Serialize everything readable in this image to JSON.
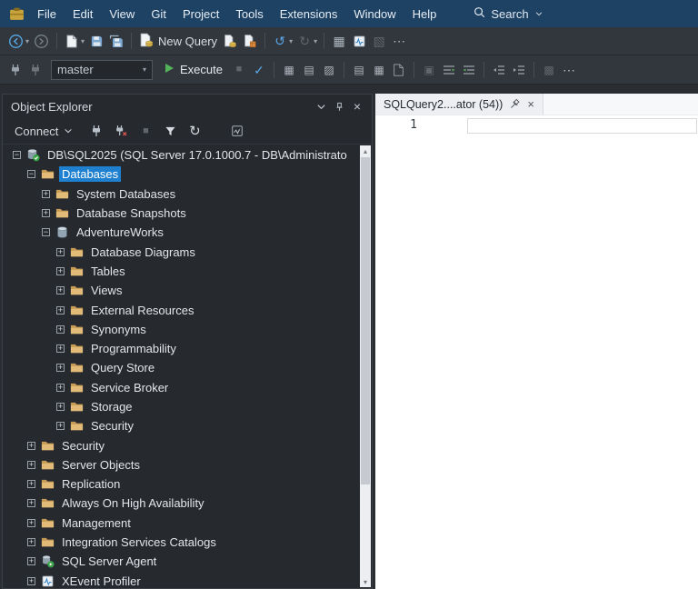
{
  "colors": {
    "menubar_bg": "#1e4264",
    "toolbar_bg": "#32373d",
    "explorer_bg": "#262a2f",
    "tree_selection": "#1f80d0",
    "execute_green": "#52b35a",
    "folder_yellow": "#e2bb79",
    "editor_bg": "#ffffff"
  },
  "menubar": {
    "items": [
      "File",
      "Edit",
      "View",
      "Git",
      "Project",
      "Tools",
      "Extensions",
      "Window",
      "Help"
    ],
    "search_label": "Search"
  },
  "standard_toolbar": {
    "new_query_label": "New Query"
  },
  "query_toolbar": {
    "database_value": "master",
    "execute_label": "Execute"
  },
  "object_explorer": {
    "title": "Object Explorer",
    "connect_label": "Connect",
    "tree": [
      {
        "label": "DB\\SQL2025 (SQL Server 17.0.1000.7 - DB\\Administrato",
        "level": 0,
        "icon": "server",
        "expander": "minus"
      },
      {
        "label": "Databases",
        "level": 1,
        "icon": "folder",
        "expander": "minus",
        "selected": true
      },
      {
        "label": "System Databases",
        "level": 2,
        "icon": "folder",
        "expander": "plus"
      },
      {
        "label": "Database Snapshots",
        "level": 2,
        "icon": "folder",
        "expander": "plus"
      },
      {
        "label": "AdventureWorks",
        "level": 2,
        "icon": "database",
        "expander": "minus"
      },
      {
        "label": "Database Diagrams",
        "level": 3,
        "icon": "folder",
        "expander": "plus"
      },
      {
        "label": "Tables",
        "level": 3,
        "icon": "folder",
        "expander": "plus"
      },
      {
        "label": "Views",
        "level": 3,
        "icon": "folder",
        "expander": "plus"
      },
      {
        "label": "External Resources",
        "level": 3,
        "icon": "folder",
        "expander": "plus"
      },
      {
        "label": "Synonyms",
        "level": 3,
        "icon": "folder",
        "expander": "plus"
      },
      {
        "label": "Programmability",
        "level": 3,
        "icon": "folder",
        "expander": "plus"
      },
      {
        "label": "Query Store",
        "level": 3,
        "icon": "folder",
        "expander": "plus"
      },
      {
        "label": "Service Broker",
        "level": 3,
        "icon": "folder",
        "expander": "plus"
      },
      {
        "label": "Storage",
        "level": 3,
        "icon": "folder",
        "expander": "plus"
      },
      {
        "label": "Security",
        "level": 3,
        "icon": "folder",
        "expander": "plus"
      },
      {
        "label": "Security",
        "level": 1,
        "icon": "folder",
        "expander": "plus"
      },
      {
        "label": "Server Objects",
        "level": 1,
        "icon": "folder",
        "expander": "plus"
      },
      {
        "label": "Replication",
        "level": 1,
        "icon": "folder",
        "expander": "plus"
      },
      {
        "label": "Always On High Availability",
        "level": 1,
        "icon": "folder",
        "expander": "plus"
      },
      {
        "label": "Management",
        "level": 1,
        "icon": "folder",
        "expander": "plus"
      },
      {
        "label": "Integration Services Catalogs",
        "level": 1,
        "icon": "folder",
        "expander": "plus"
      },
      {
        "label": "SQL Server Agent",
        "level": 1,
        "icon": "agent",
        "expander": "plus"
      },
      {
        "label": "XEvent Profiler",
        "level": 1,
        "icon": "xevent",
        "expander": "plus"
      }
    ]
  },
  "editor": {
    "tab_title": "SQLQuery2....ator (54))",
    "line_number": "1"
  }
}
